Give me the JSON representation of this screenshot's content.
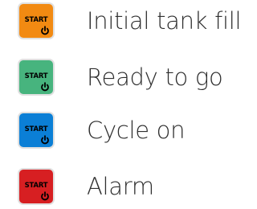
{
  "legend": {
    "items": [
      {
        "button_label": "START",
        "color": "#F28A12",
        "label": "Initial tank fill",
        "icon": "power-icon"
      },
      {
        "button_label": "START",
        "color": "#47B47E",
        "label": "Ready to go",
        "icon": "power-icon"
      },
      {
        "button_label": "START",
        "color": "#0B7FD6",
        "label": "Cycle on",
        "icon": "power-icon"
      },
      {
        "button_label": "START",
        "color": "#D71F22",
        "label": "Alarm",
        "icon": "power-icon"
      }
    ]
  }
}
